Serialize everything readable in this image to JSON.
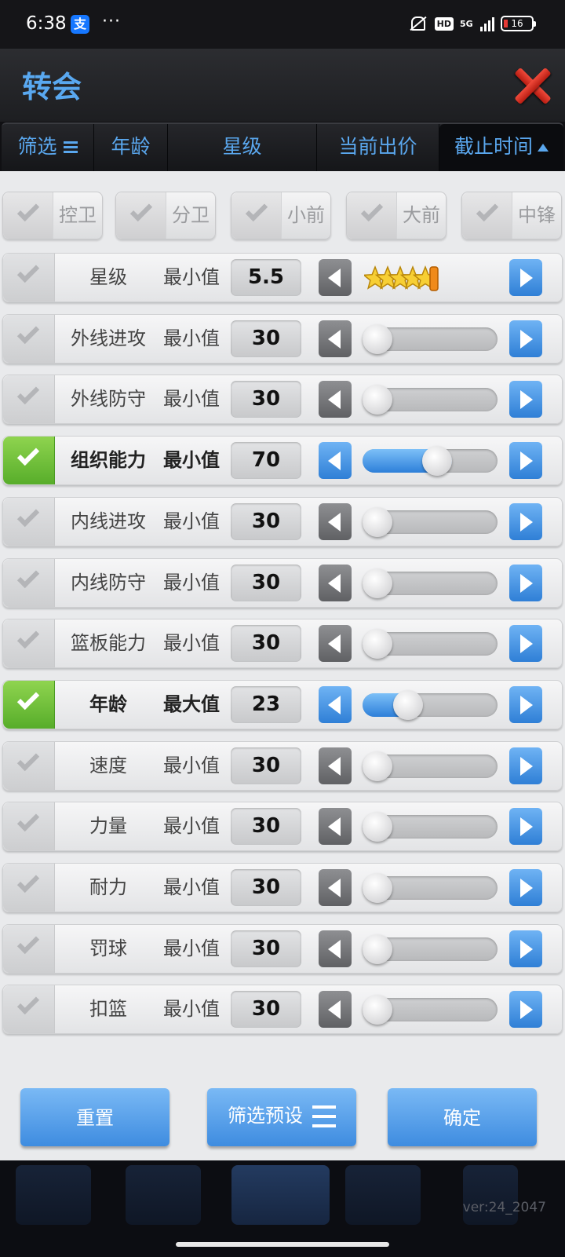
{
  "status_bar": {
    "time": "6:38",
    "app_badge": "支",
    "more": "···",
    "hd": "HD",
    "network": "5G",
    "battery": "16"
  },
  "header": {
    "title": "转会"
  },
  "sort_bar": {
    "filter": "筛选",
    "age": "年龄",
    "stars": "星级",
    "current_bid": "当前出价",
    "deadline": "截止时间"
  },
  "positions": [
    {
      "label": "控卫",
      "checked": false
    },
    {
      "label": "分卫",
      "checked": false
    },
    {
      "label": "小前",
      "checked": false
    },
    {
      "label": "大前",
      "checked": false
    },
    {
      "label": "中锋",
      "checked": false
    }
  ],
  "filters": [
    {
      "name": "星级",
      "mode": "最小值",
      "value": "5.5",
      "enabled": false,
      "type": "stars",
      "stars_filled": 5.5
    },
    {
      "name": "外线进攻",
      "mode": "最小值",
      "value": "30",
      "enabled": false,
      "level": 0.0
    },
    {
      "name": "外线防守",
      "mode": "最小值",
      "value": "30",
      "enabled": false,
      "level": 0.0
    },
    {
      "name": "组织能力",
      "mode": "最小值",
      "value": "70",
      "enabled": true,
      "level": 0.57
    },
    {
      "name": "内线进攻",
      "mode": "最小值",
      "value": "30",
      "enabled": false,
      "level": 0.0
    },
    {
      "name": "内线防守",
      "mode": "最小值",
      "value": "30",
      "enabled": false,
      "level": 0.0
    },
    {
      "name": "篮板能力",
      "mode": "最小值",
      "value": "30",
      "enabled": false,
      "level": 0.0
    },
    {
      "name": "年龄",
      "mode": "最大值",
      "value": "23",
      "enabled": true,
      "level": 0.29
    },
    {
      "name": "速度",
      "mode": "最小值",
      "value": "30",
      "enabled": false,
      "level": 0.0
    },
    {
      "name": "力量",
      "mode": "最小值",
      "value": "30",
      "enabled": false,
      "level": 0.0
    },
    {
      "name": "耐力",
      "mode": "最小值",
      "value": "30",
      "enabled": false,
      "level": 0.0
    },
    {
      "name": "罚球",
      "mode": "最小值",
      "value": "30",
      "enabled": false,
      "level": 0.0
    },
    {
      "name": "扣篮",
      "mode": "最小值",
      "value": "30",
      "enabled": false,
      "level": 0.0
    }
  ],
  "buttons": {
    "reset": "重置",
    "presets": "筛选预设",
    "confirm": "确定"
  },
  "version": "ver:24_2047",
  "colors": {
    "accent": "#5aa7ee",
    "enabled_check": "#6cc03a",
    "close": "#e0392b"
  }
}
